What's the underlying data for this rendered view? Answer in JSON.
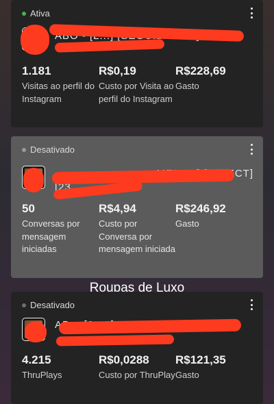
{
  "cards": [
    {
      "status": "Ativa",
      "status_color": "#4caf50",
      "name": "ABO - [L...] [SEGUIDORES]",
      "name_line2": "[...",
      "metrics": [
        {
          "value": "1.181",
          "label": "Visitas ao perfil do Instagram"
        },
        {
          "value": "R$0,19",
          "label": "Custo por Visita ao perfil do Instagram"
        },
        {
          "value": "R$228,69",
          "label": "Gasto"
        }
      ]
    },
    {
      "status": "Desativado",
      "status_color": "#9a9a9a",
      "name": "...MENTO] [DIRECT]",
      "name_line2": "[23 ...",
      "metrics": [
        {
          "value": "50",
          "label": "Conversas por mensagem iniciadas"
        },
        {
          "value": "R$4,94",
          "label": "Custo por Conversa por mensagem iniciada"
        },
        {
          "value": "R$246,92",
          "label": "Gasto"
        }
      ]
    },
    {
      "status": "Desativado",
      "status_color": "#6e6e6e",
      "name": "AB... [2...2]",
      "name_line2": "",
      "metrics": [
        {
          "value": "4.215",
          "label": "ThruPlays"
        },
        {
          "value": "R$0,0288",
          "label": "Custo por ThruPlay"
        },
        {
          "value": "R$121,35",
          "label": "Gasto"
        }
      ]
    }
  ],
  "section_title": "Roupas de Luxo",
  "icons": {
    "menu": "more-vertical-icon",
    "status": "status-dot-icon",
    "thumbnail": "ad-thumbnail"
  },
  "colors": {
    "redaction": "#ff3b1f",
    "card_dark": "#232323",
    "card_disabled": "#5b5b5b"
  }
}
